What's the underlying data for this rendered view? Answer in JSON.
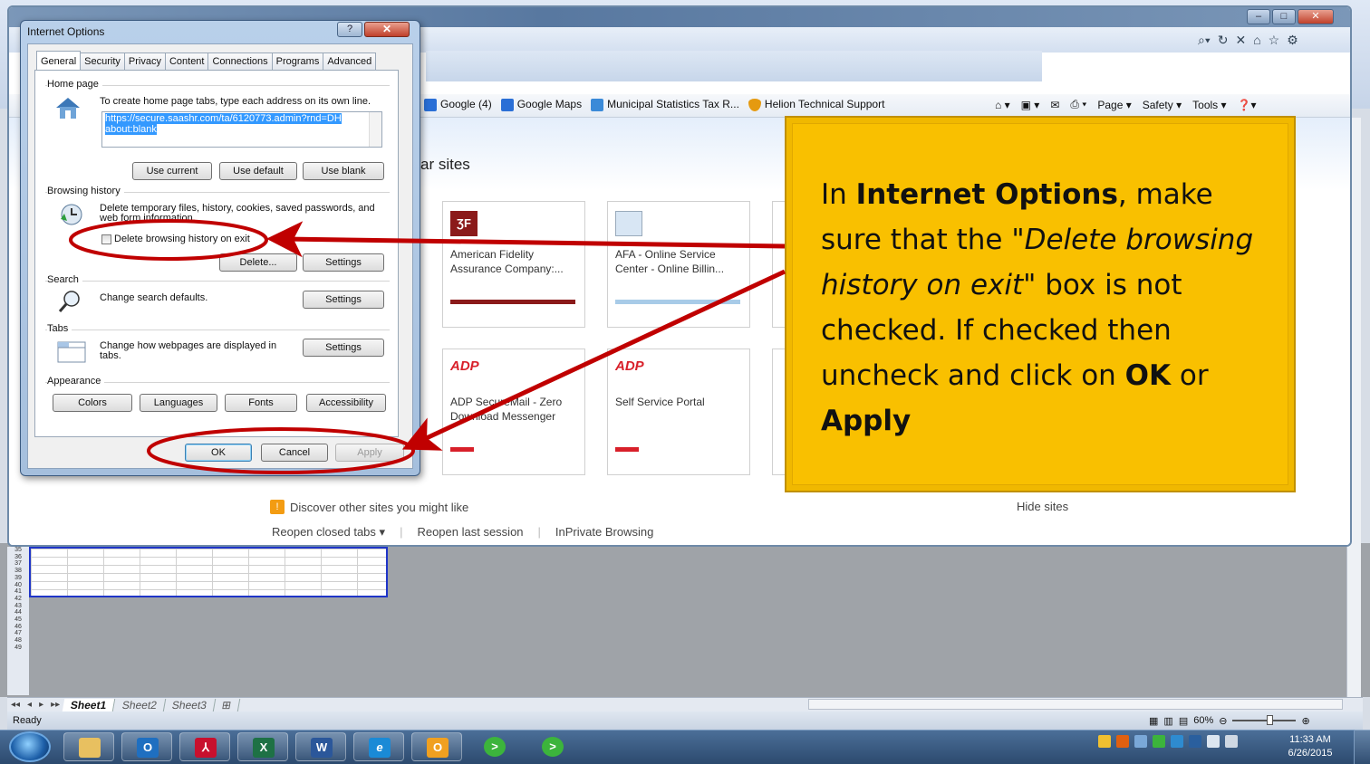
{
  "excel": {
    "row_numbers": [
      "35",
      "36",
      "37",
      "38",
      "39",
      "40",
      "41",
      "42",
      "43",
      "44",
      "45",
      "46",
      "47",
      "48",
      "49"
    ],
    "sheet_tabs": [
      "Sheet1",
      "Sheet2",
      "Sheet3"
    ],
    "status": "Ready",
    "zoom": "60%"
  },
  "ie": {
    "favorites": [
      {
        "label": "Google (4)",
        "icon": "google-icon",
        "color": "#2a6fd6"
      },
      {
        "label": "Google Maps",
        "icon": "google-icon",
        "color": "#2a6fd6"
      },
      {
        "label": "Municipal Statistics Tax R...",
        "icon": "ie-page-icon",
        "color": "#3a8ad8"
      },
      {
        "label": "Helion Technical Support",
        "icon": "shield-icon",
        "color": "#e59a10"
      }
    ],
    "command_bar": {
      "page": "Page ▾",
      "safety": "Safety ▾",
      "tools": "Tools ▾"
    },
    "frequent_title": "ar sites",
    "tiles": [
      {
        "name": "American Fidelity Assurance Company:...",
        "bar_color": "#8b1a1a"
      },
      {
        "name": "AFA - Online Service Center - Online Billin...",
        "bar_color": "#a8cbe8"
      },
      {
        "name": "ADP SecureMail - Zero Download Messenger",
        "bar_color": "#d8202a"
      },
      {
        "name": "Self Service Portal",
        "bar_color": "#d8202a"
      }
    ],
    "discover": "Discover other sites you might like",
    "hide_sites": "Hide sites",
    "reopen_closed": "Reopen closed tabs ▾",
    "reopen_last": "Reopen last session",
    "inprivate": "InPrivate Browsing"
  },
  "dialog": {
    "title": "Internet Options",
    "tabs": [
      "General",
      "Security",
      "Privacy",
      "Content",
      "Connections",
      "Programs",
      "Advanced"
    ],
    "home_page": {
      "heading": "Home page",
      "description": "To create home page tabs, type each address on its own line.",
      "urls_line1": "https://secure.saashr.com/ta/6120773.admin?rnd=DH",
      "urls_line2": "about:blank",
      "use_current": "Use current",
      "use_default": "Use default",
      "use_blank": "Use blank"
    },
    "browsing_history": {
      "heading": "Browsing history",
      "description": "Delete temporary files, history, cookies, saved passwords, and web form information.",
      "checkbox_label": "Delete browsing history on exit",
      "checked": false,
      "delete": "Delete...",
      "settings": "Settings"
    },
    "search": {
      "heading": "Search",
      "description": "Change search defaults.",
      "settings": "Settings"
    },
    "tabs_section": {
      "heading": "Tabs",
      "description": "Change how webpages are displayed in tabs.",
      "settings": "Settings"
    },
    "appearance": {
      "heading": "Appearance",
      "colors": "Colors",
      "languages": "Languages",
      "fonts": "Fonts",
      "accessibility": "Accessibility"
    },
    "ok": "OK",
    "cancel": "Cancel",
    "apply": "Apply"
  },
  "callout": {
    "t1": "In ",
    "b1": "Internet Options",
    "t2": ", make sure that the \"",
    "i1": "Delete browsing history on exit\"",
    "t3": " box is not checked. If checked then uncheck and click on ",
    "b2": "OK",
    "t4": " or ",
    "b3": "Apply",
    "accent": "#f9c000",
    "annotation_color": "#c00000"
  },
  "taskbar": {
    "apps": [
      "explorer",
      "outlook",
      "acrobat",
      "excel",
      "word",
      "internet-explorer",
      "outlook-mail",
      "media-1",
      "media-2"
    ],
    "time": "11:33 AM",
    "date": "6/26/2015"
  }
}
